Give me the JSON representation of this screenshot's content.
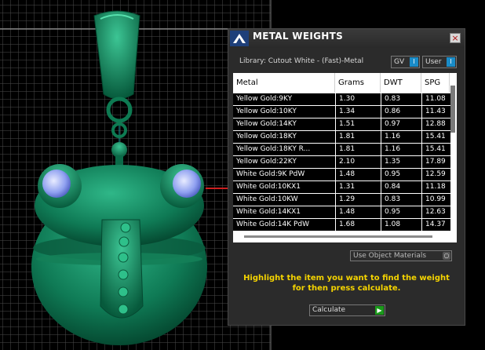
{
  "dialog": {
    "title": "METAL WEIGHTS",
    "close_glyph": "×",
    "library_label": "Library: Cutout White - (Fast)-Metal",
    "units": [
      {
        "label": "GV",
        "indicator": "I"
      },
      {
        "label": "User",
        "indicator": "I"
      }
    ],
    "table": {
      "columns": [
        "Metal",
        "Grams",
        "DWT",
        "SPG"
      ],
      "rows": [
        [
          "Yellow Gold:9KY",
          "1.30",
          "0.83",
          "11.08"
        ],
        [
          "Yellow Gold:10KY",
          "1.34",
          "0.86",
          "11.43"
        ],
        [
          "Yellow Gold:14KY",
          "1.51",
          "0.97",
          "12.88"
        ],
        [
          "Yellow Gold:18KY",
          "1.81",
          "1.16",
          "15.41"
        ],
        [
          "Yellow Gold:18KY R...",
          "1.81",
          "1.16",
          "15.41"
        ],
        [
          "Yellow Gold:22KY",
          "2.10",
          "1.35",
          "17.89"
        ],
        [
          "White Gold:9K PdW",
          "1.48",
          "0.95",
          "12.59"
        ],
        [
          "White Gold:10KX1",
          "1.31",
          "0.84",
          "11.18"
        ],
        [
          "White Gold:10KW",
          "1.29",
          "0.83",
          "10.99"
        ],
        [
          "White Gold:14KX1",
          "1.48",
          "0.95",
          "12.63"
        ],
        [
          "White Gold:14K PdW",
          "1.68",
          "1.08",
          "14.37"
        ]
      ]
    },
    "object_materials": {
      "label": "Use Object Materials",
      "indicator": "○"
    },
    "instructions": "Highlight the item you want to find the weight for then press calculate.",
    "calculate": {
      "label": "Calculate",
      "arrow": "▶"
    }
  },
  "colors": {
    "model": "#0f7a55",
    "instruction_text": "#f5d400",
    "toggle_blue": "#1a8cc8",
    "calculate_green": "#1a9a1a"
  }
}
